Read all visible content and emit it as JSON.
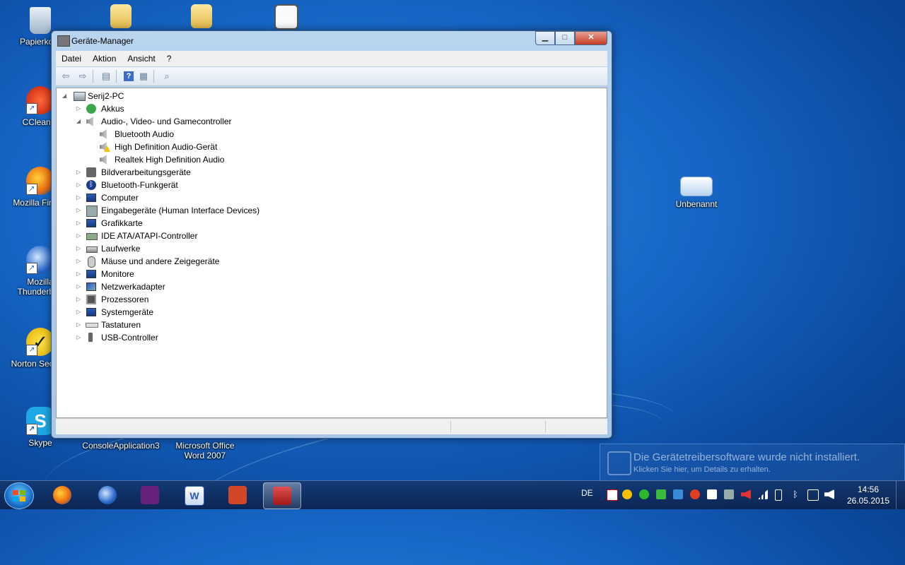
{
  "window": {
    "title": "Geräte-Manager",
    "buttons": {
      "minimize": "▁",
      "maximize": "□",
      "close": "✕"
    }
  },
  "menu": [
    "Datei",
    "Aktion",
    "Ansicht",
    "?"
  ],
  "tree": {
    "root": "Serij2-PC",
    "items": [
      {
        "label": "Akkus",
        "expanded": false,
        "icon": "battery-icon"
      },
      {
        "label": "Audio-, Video- und Gamecontroller",
        "expanded": true,
        "icon": "speaker-icon",
        "children": [
          {
            "label": "Bluetooth Audio",
            "icon": "speaker-icon",
            "warning": false
          },
          {
            "label": "High Definition Audio-Gerät",
            "icon": "speaker-icon",
            "warning": true
          },
          {
            "label": "Realtek High Definition Audio",
            "icon": "speaker-icon",
            "warning": false
          }
        ]
      },
      {
        "label": "Bildverarbeitungsgeräte",
        "expanded": false,
        "icon": "camera-icon"
      },
      {
        "label": "Bluetooth-Funkgerät",
        "expanded": false,
        "icon": "bluetooth-icon"
      },
      {
        "label": "Computer",
        "expanded": false,
        "icon": "computer-icon"
      },
      {
        "label": "Eingabegeräte (Human Interface Devices)",
        "expanded": false,
        "icon": "hid-icon"
      },
      {
        "label": "Grafikkarte",
        "expanded": false,
        "icon": "display-adapter-icon"
      },
      {
        "label": "IDE ATA/ATAPI-Controller",
        "expanded": false,
        "icon": "ide-controller-icon"
      },
      {
        "label": "Laufwerke",
        "expanded": false,
        "icon": "drive-icon"
      },
      {
        "label": "Mäuse und andere Zeigegeräte",
        "expanded": false,
        "icon": "mouse-icon"
      },
      {
        "label": "Monitore",
        "expanded": false,
        "icon": "monitor-icon"
      },
      {
        "label": "Netzwerkadapter",
        "expanded": false,
        "icon": "network-icon"
      },
      {
        "label": "Prozessoren",
        "expanded": false,
        "icon": "cpu-icon"
      },
      {
        "label": "Systemgeräte",
        "expanded": false,
        "icon": "system-icon"
      },
      {
        "label": "Tastaturen",
        "expanded": false,
        "icon": "keyboard-icon"
      },
      {
        "label": "USB-Controller",
        "expanded": false,
        "icon": "usb-icon"
      }
    ]
  },
  "desktop_icons": [
    {
      "label": "Papierkorb",
      "icon": "recycle-bin-icon"
    },
    {
      "label": "CCleaner",
      "icon": "ccleaner-icon"
    },
    {
      "label": "Mozilla Firefox",
      "icon": "firefox-icon"
    },
    {
      "label": "Mozilla Thunderbird",
      "icon": "thunderbird-icon"
    },
    {
      "label": "Norton Security",
      "icon": "norton-icon"
    },
    {
      "label": "Skype",
      "icon": "skype-icon"
    },
    {
      "label": "ConsoleApplication3",
      "icon": "folder-icon"
    },
    {
      "label": "Microsoft Office Word 2007",
      "icon": "word-icon"
    },
    {
      "label": "Unbenannt",
      "icon": "image-file-icon"
    }
  ],
  "notification": {
    "title": "Die Gerätetreibersoftware wurde nicht installiert.",
    "subtitle": "Klicken Sie hier, um Details zu erhalten."
  },
  "taskbar": {
    "language": "DE",
    "time": "14:56",
    "date": "26.05.2015"
  },
  "colors": {
    "accent": "#1665c4",
    "warning": "#f2c200"
  }
}
